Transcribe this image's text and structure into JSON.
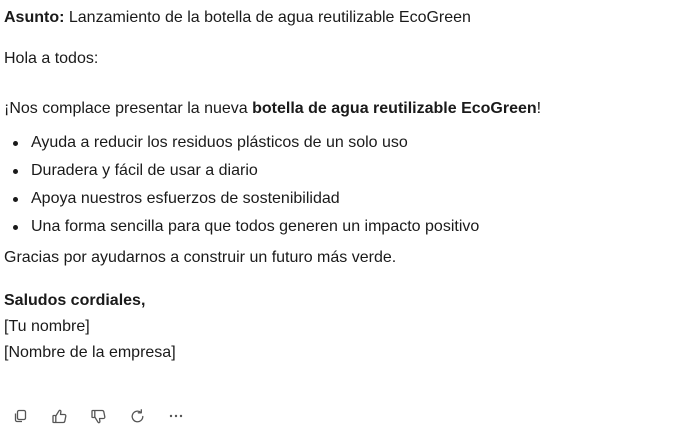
{
  "email": {
    "subject_label": "Asunto:",
    "subject_text": " Lanzamiento de la botella de agua reutilizable EcoGreen",
    "greeting": "Hola a todos:",
    "intro_prefix": "¡Nos complace presentar la nueva ",
    "intro_bold": "botella de agua reutilizable EcoGreen",
    "intro_suffix": "!",
    "bullets": [
      "Ayuda a reducir los residuos plásticos de un solo uso",
      "Duradera y fácil de usar a diario",
      "Apoya nuestros esfuerzos de sostenibilidad",
      "Una forma sencilla para que todos generen un impacto positivo"
    ],
    "closing": "Gracias por ayudarnos a construir un futuro más verde.",
    "signoff": "Saludos cordiales,",
    "name_placeholder": "[Tu nombre]",
    "company_placeholder": "[Nombre de la empresa]"
  },
  "actions": [
    {
      "icon": "copy-icon"
    },
    {
      "icon": "thumbs-up-icon"
    },
    {
      "icon": "thumbs-down-icon"
    },
    {
      "icon": "regenerate-icon"
    },
    {
      "icon": "more-icon"
    }
  ],
  "colors": {
    "text": "#1a1a1a",
    "icon": "#555555",
    "background": "#ffffff"
  }
}
